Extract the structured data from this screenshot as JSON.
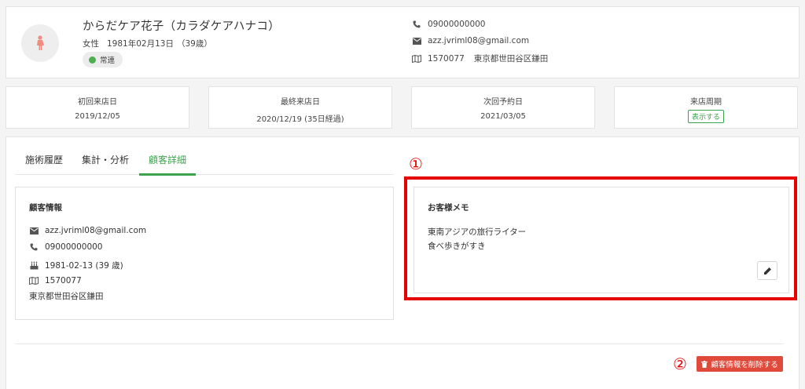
{
  "customer": {
    "name": "からだケア花子（カラダケアハナコ）",
    "gender": "女性",
    "birthday": "1981年02月13日",
    "age": "（39歳）",
    "status": "常連",
    "phone": "09000000000",
    "email": "azz.jvriml08@gmail.com",
    "postal": "1570077",
    "address": "東京都世田谷区鎌田"
  },
  "stats": [
    {
      "label": "初回来店日",
      "value": "2019/12/05"
    },
    {
      "label": "最終来店日",
      "value": "2020/12/19 (35日経過)"
    },
    {
      "label": "次回予約日",
      "value": "2021/03/05"
    },
    {
      "label": "来店周期",
      "button": "表示する"
    }
  ],
  "tabs": [
    {
      "label": "施術履歴"
    },
    {
      "label": "集計・分析"
    },
    {
      "label": "顧客詳細"
    }
  ],
  "info_panel": {
    "title": "顧客情報",
    "email": "azz.jvriml08@gmail.com",
    "phone": "09000000000",
    "birthdate": "1981-02-13 (39 歳)",
    "postal": "1570077",
    "address": "東京都世田谷区鎌田"
  },
  "memo_panel": {
    "title": "お客様メモ",
    "lines": [
      "東南アジアの旅行ライター",
      "食べ歩きがすき"
    ]
  },
  "annotations": {
    "one": "①",
    "two": "②"
  },
  "delete_label": "顧客情報を削除する",
  "icons": [
    "female-icon",
    "phone-icon",
    "mail-icon",
    "map-icon",
    "cake-icon",
    "pencil-icon",
    "trash-icon"
  ],
  "colors": {
    "accent": "#3ba34c",
    "danger": "#e04a3a",
    "highlight": "#e60000"
  }
}
